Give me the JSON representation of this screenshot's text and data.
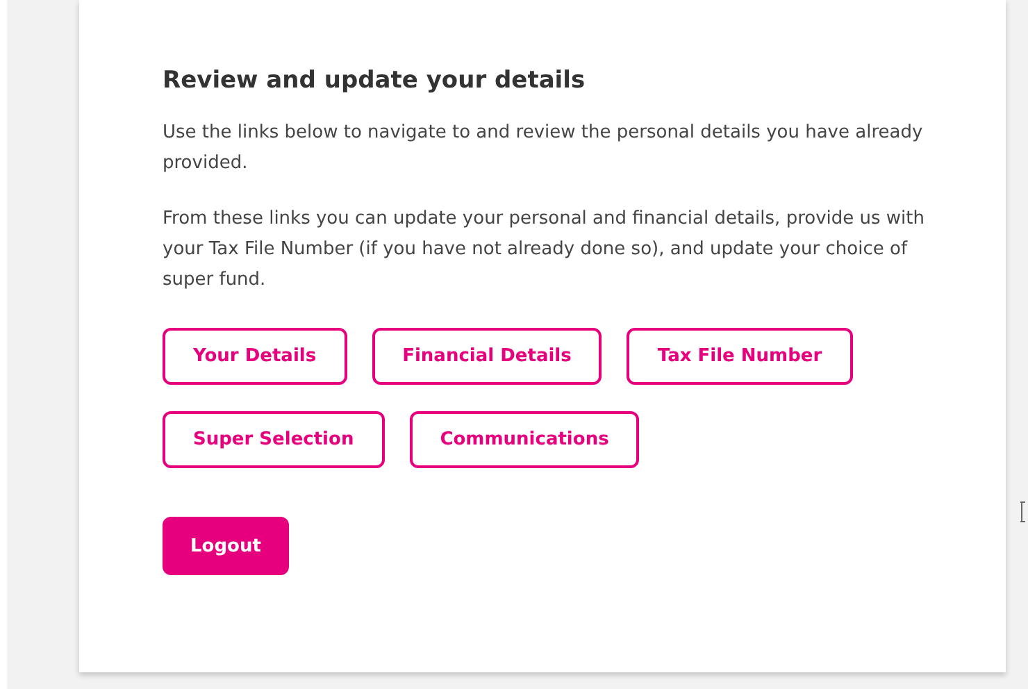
{
  "heading": "Review and update your details",
  "paragraphs": [
    "Use the links below to navigate to and review the personal details you have already provided.",
    "From these links you can update your personal and financial details, provide us with your Tax File Number (if you have not already done so), and update your choice of super fund."
  ],
  "link_rows": [
    [
      "Your Details",
      "Financial Details",
      "Tax File Number"
    ],
    [
      "Super Selection",
      "Communications"
    ]
  ],
  "logout_button": "Logout"
}
